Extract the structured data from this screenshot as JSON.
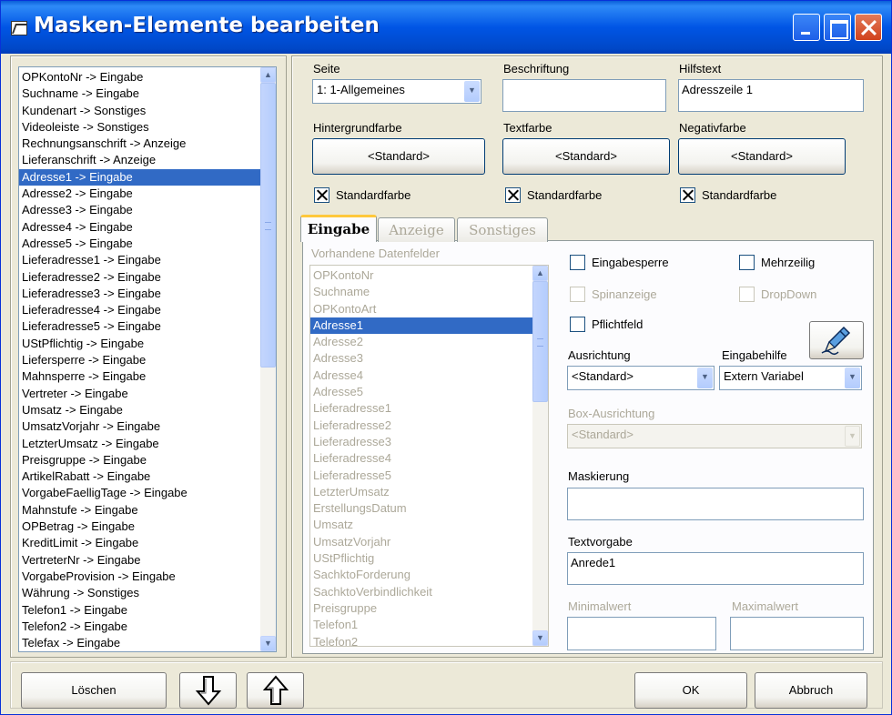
{
  "window": {
    "title": "Masken-Elemente bearbeiten"
  },
  "fields_list": {
    "items": [
      "OPKontoNr -> Eingabe",
      "Suchname -> Eingabe",
      "Kundenart -> Sonstiges",
      "Videoleiste -> Sonstiges",
      "Rechnungsanschrift -> Anzeige",
      "Lieferanschrift -> Anzeige",
      "Adresse1 -> Eingabe",
      "Adresse2 -> Eingabe",
      "Adresse3 -> Eingabe",
      "Adresse4 -> Eingabe",
      "Adresse5 -> Eingabe",
      "Lieferadresse1 -> Eingabe",
      "Lieferadresse2 -> Eingabe",
      "Lieferadresse3 -> Eingabe",
      "Lieferadresse4 -> Eingabe",
      "Lieferadresse5 -> Eingabe",
      "UStPflichtig -> Eingabe",
      "Liefersperre -> Eingabe",
      "Mahnsperre -> Eingabe",
      "Vertreter -> Eingabe",
      "Umsatz -> Eingabe",
      "UmsatzVorjahr -> Eingabe",
      "LetzterUmsatz -> Eingabe",
      "Preisgruppe -> Eingabe",
      "ArtikelRabatt -> Eingabe",
      "VorgabeFaelligTage -> Eingabe",
      "Mahnstufe -> Eingabe",
      "OPBetrag -> Eingabe",
      "KreditLimit -> Eingabe",
      "VertreterNr -> Eingabe",
      "VorgabeProvision -> Eingabe",
      "Währung -> Sonstiges",
      "Telefon1 -> Eingabe",
      "Telefon2 -> Eingabe",
      "Telefax -> Eingabe"
    ],
    "selected_index": 6
  },
  "seite": {
    "label": "Seite",
    "value": "1: 1-Allgemeines"
  },
  "beschriftung": {
    "label": "Beschriftung",
    "value": ""
  },
  "hilfstext": {
    "label": "Hilfstext",
    "value": "Adresszeile 1"
  },
  "hintergrundfarbe": {
    "label": "Hintergrundfarbe",
    "button": "<Standard>",
    "check_label": "Standardfarbe",
    "checked": true
  },
  "textfarbe": {
    "label": "Textfarbe",
    "button": "<Standard>",
    "check_label": "Standardfarbe",
    "checked": true
  },
  "negativfarbe": {
    "label": "Negativfarbe",
    "button": "<Standard>",
    "check_label": "Standardfarbe",
    "checked": true
  },
  "tabs": [
    {
      "label": "Eingabe",
      "active": true
    },
    {
      "label": "Anzeige",
      "active": false
    },
    {
      "label": "Sonstiges",
      "active": false
    }
  ],
  "eingabe": {
    "datenfelder_label": "Vorhandene Datenfelder",
    "datenfelder": [
      "OPKontoNr",
      "Suchname",
      "OPKontoArt",
      "Adresse1",
      "Adresse2",
      "Adresse3",
      "Adresse4",
      "Adresse5",
      "Lieferadresse1",
      "Lieferadresse2",
      "Lieferadresse3",
      "Lieferadresse4",
      "Lieferadresse5",
      "LetzterUmsatz",
      "ErstellungsDatum",
      "Umsatz",
      "UmsatzVorjahr",
      "UStPflichtig",
      "SachktoForderung",
      "SachktoVerbindlichkeit",
      "Preisgruppe",
      "Telefon1",
      "Telefon2"
    ],
    "datenfelder_selected_index": 3,
    "eingabesperre": {
      "label": "Eingabesperre",
      "checked": false
    },
    "mehrzeilig": {
      "label": "Mehrzeilig",
      "checked": false
    },
    "spinanzeige": {
      "label": "Spinanzeige",
      "checked": false
    },
    "dropdown": {
      "label": "DropDown",
      "checked": false
    },
    "pflichtfeld": {
      "label": "Pflichtfeld",
      "checked": false
    },
    "ausrichtung": {
      "label": "Ausrichtung",
      "value": "<Standard>"
    },
    "eingabehilfe": {
      "label": "Eingabehilfe",
      "value": "Extern Variabel"
    },
    "box_ausrichtung": {
      "label": "Box-Ausrichtung",
      "value": "<Standard>"
    },
    "maskierung": {
      "label": "Maskierung",
      "value": ""
    },
    "textvorgabe": {
      "label": "Textvorgabe",
      "value": "Anrede1"
    },
    "minimalwert": {
      "label": "Minimalwert",
      "value": ""
    },
    "maximalwert": {
      "label": "Maximalwert",
      "value": ""
    }
  },
  "footer": {
    "delete": "Löschen",
    "ok": "OK",
    "cancel": "Abbruch"
  }
}
